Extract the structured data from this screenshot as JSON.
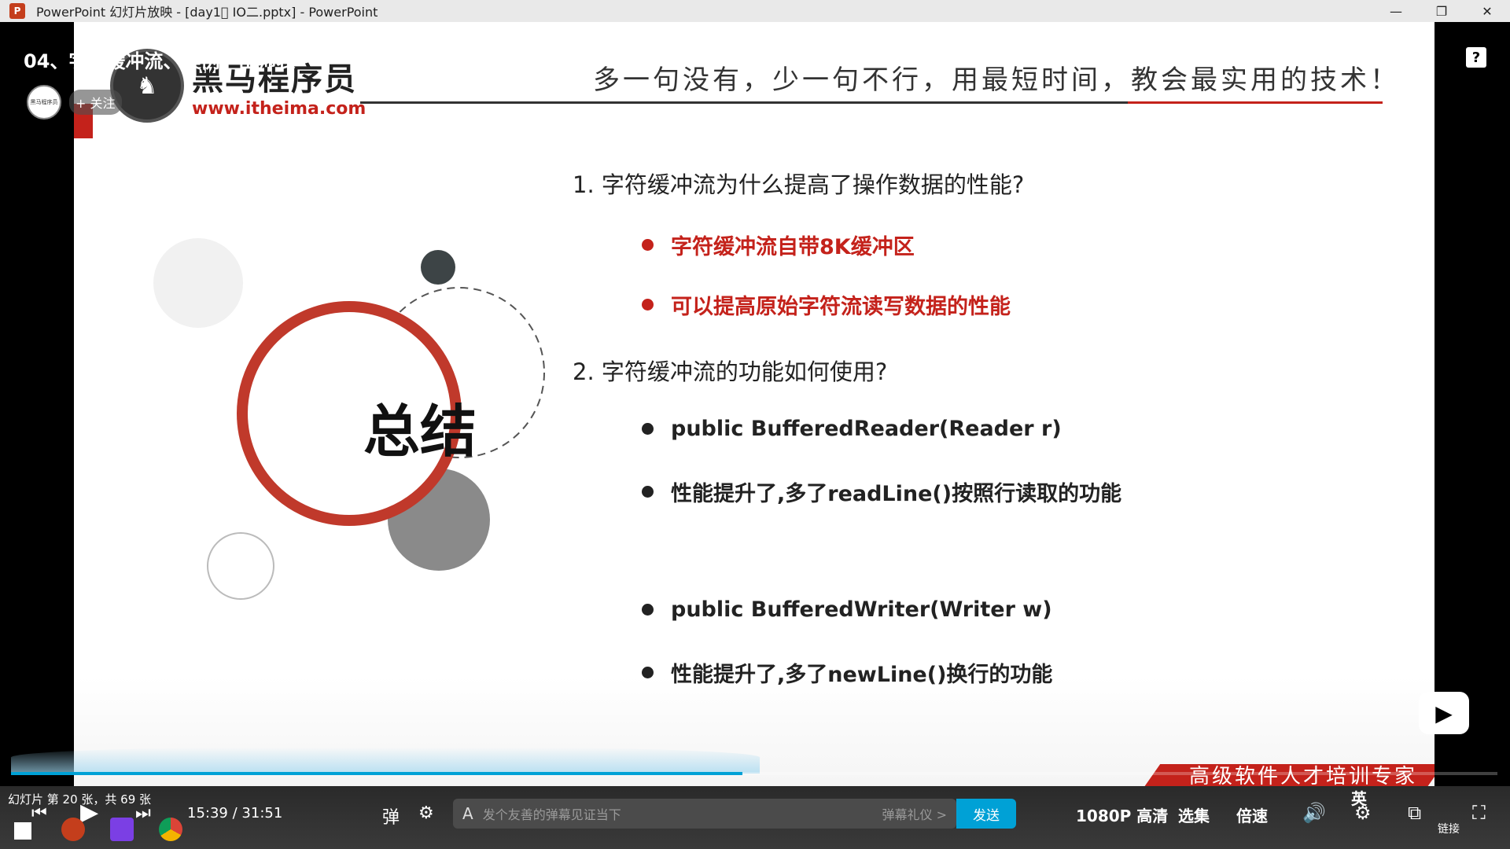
{
  "window": {
    "title": "PowerPoint 幻灯片放映 - [day1\u0000  IO二.pptx] - PowerPoint",
    "minimize": "—",
    "restore": "❐",
    "close": "✕",
    "app_icon": "P"
  },
  "video": {
    "title": "04、字符缓冲流、案例：出师表",
    "follow_label": "+ 关注",
    "avatar_label": "黑马程序员"
  },
  "slide": {
    "logo_cn": "黑马程序员",
    "logo_url": "www.itheima.com",
    "slogan": "多一句没有，少一句不行，用最短时间，教会最实用的技术！",
    "center_title": "总结",
    "q1": "1.  字符缓冲流为什么提高了操作数据的性能?",
    "q1_bullets": [
      "字符缓冲流自带8K缓冲区",
      "可以提高原始字符流读写数据的性能"
    ],
    "q2": "2.  字符缓冲流的功能如何使用?",
    "q2_bullets": [
      "public BufferedReader(Reader r)",
      "性能提升了,多了readLine()按照行读取的功能",
      "public BufferedWriter(Writer w)",
      "性能提升了,多了newLine()换行的功能"
    ],
    "footer": "高级软件人才培训专家"
  },
  "player": {
    "help": "?",
    "slide_status": "幻灯片 第 20 张，共 69 张",
    "time_current": "15:39",
    "time_sep": "/",
    "time_total": "31:51",
    "progress_fraction": 0.492,
    "danmaku_placeholder": "发个友善的弹幕见证当下",
    "danmaku_etiquette": "弹幕礼仪 >",
    "send_label": "发送",
    "quality": "1080P 高清",
    "episodes": "选集",
    "speed": "倍速",
    "link": "链接",
    "lang": "英"
  },
  "colors": {
    "accent_red": "#c4221b",
    "bilibili_blue": "#00a1d6"
  }
}
